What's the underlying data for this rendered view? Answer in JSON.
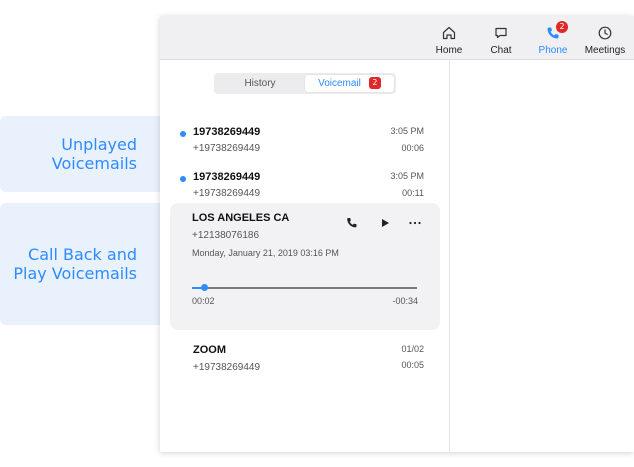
{
  "callouts": {
    "unplayed": {
      "line1": "Unplayed",
      "line2": "Voicemails"
    },
    "callback": {
      "line1": "Call Back and",
      "line2": "Play Voicemails"
    }
  },
  "nav": {
    "home": "Home",
    "chat": "Chat",
    "phone": "Phone",
    "phone_badge": "2",
    "meetings": "Meetings"
  },
  "tabs": {
    "history": "History",
    "voicemail": "Voicemail",
    "voicemail_badge": "2"
  },
  "voicemails": [
    {
      "name": "19738269449",
      "number": "+19738269449",
      "time": "3:05 PM",
      "duration": "00:06",
      "unplayed": true
    },
    {
      "name": "19738269449",
      "number": "+19738269449",
      "time": "3:05 PM",
      "duration": "00:11",
      "unplayed": true
    },
    {
      "name": "LOS ANGELES  CA",
      "number": "+12138076186",
      "date": "Monday, January 21, 2019 03:16 PM",
      "elapsed": "00:02",
      "remaining": "-00:34",
      "progress": 0.056
    },
    {
      "name": "ZOOM",
      "number": "+19738269449",
      "time": "01/02",
      "duration": "00:05",
      "unplayed": false
    }
  ],
  "colors": {
    "accent": "#2d8cff",
    "badge": "#e02828",
    "callout_bg": "#e8f1fc"
  }
}
